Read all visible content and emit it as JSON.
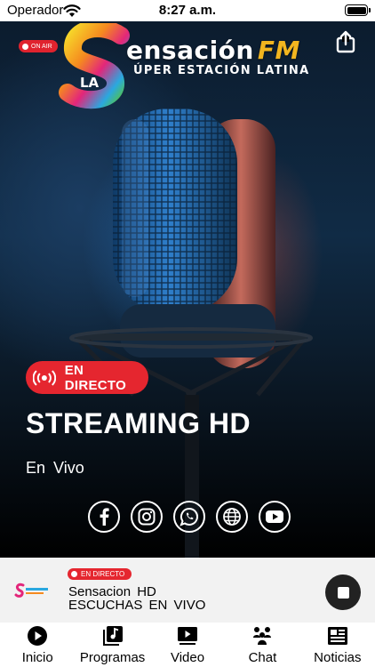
{
  "status_bar": {
    "carrier": "Operador",
    "time": "8:27 a.m."
  },
  "header": {
    "on_air_label": "ON AIR",
    "logo": {
      "prefix": "LA",
      "brand": "ensación",
      "brand_suffix": "FM",
      "tagline": "ÚPER ESTACIÓN LATINA"
    }
  },
  "hero": {
    "live_badge": "EN DIRECTO",
    "title": "STREAMING HD",
    "subtitle": "En Vivo"
  },
  "socials": [
    "facebook-icon",
    "instagram-icon",
    "whatsapp-icon",
    "globe-icon",
    "youtube-icon"
  ],
  "player": {
    "live_pill": "EN DIRECTO",
    "title": "Sensacion HD",
    "subtitle": "ESCUCHAS EN VIVO"
  },
  "tabs": [
    {
      "label": "Inicio",
      "icon": "play-circle-icon"
    },
    {
      "label": "Programas",
      "icon": "music-library-icon"
    },
    {
      "label": "Video",
      "icon": "video-screen-icon"
    },
    {
      "label": "Chat",
      "icon": "users-icon"
    },
    {
      "label": "Noticias",
      "icon": "news-icon"
    }
  ],
  "colors": {
    "accent_red": "#e5262f",
    "logo_gold": "#f2b51f",
    "player_bg": "#f2f2f2"
  }
}
